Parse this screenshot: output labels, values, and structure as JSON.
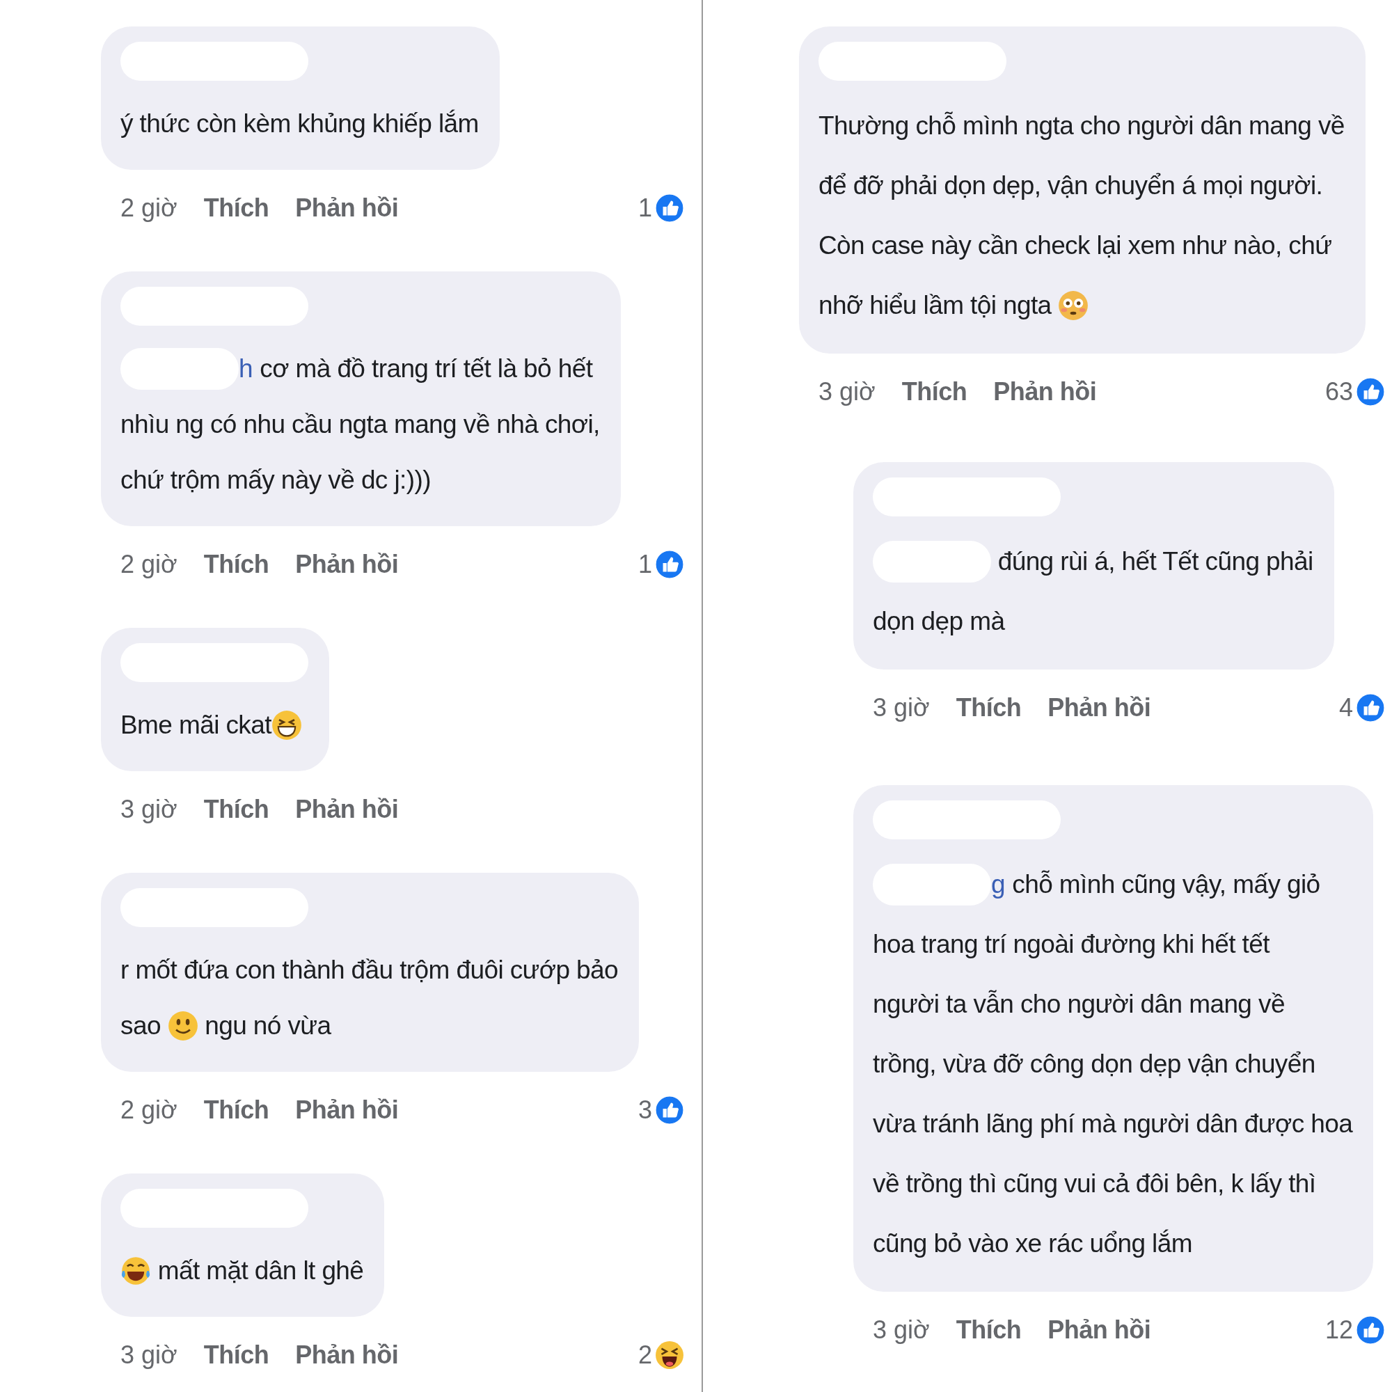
{
  "columns": [
    {
      "comments": [
        {
          "lines": [
            [
              {
                "kind": "text",
                "text": "ý thức còn kèm khủng khiếp lắm"
              }
            ]
          ],
          "time": "2 giờ",
          "like": "Thích",
          "reply": "Phản hồi",
          "reaction": {
            "kind": "like",
            "count": "1"
          }
        },
        {
          "lines": [
            [
              {
                "kind": "mention",
                "text": "h"
              },
              {
                "kind": "text",
                "text": " cơ mà đồ trang trí tết là bỏ hết"
              }
            ],
            [
              {
                "kind": "text",
                "text": "nhìu ng có nhu cầu ngta mang về nhà chơi,"
              }
            ],
            [
              {
                "kind": "text",
                "text": "chứ trộm mấy này về dc j:)))"
              }
            ]
          ],
          "time": "2 giờ",
          "like": "Thích",
          "reply": "Phản hồi",
          "reaction": {
            "kind": "like",
            "count": "1"
          }
        },
        {
          "lines": [
            [
              {
                "kind": "text",
                "text": "Bme mãi ckat"
              },
              {
                "kind": "grin"
              }
            ]
          ],
          "time": "3 giờ",
          "like": "Thích",
          "reply": "Phản hồi"
        },
        {
          "lines": [
            [
              {
                "kind": "text",
                "text": "r mốt đứa con thành đầu trộm đuôi cướp bảo"
              }
            ],
            [
              {
                "kind": "text",
                "text": "sao "
              },
              {
                "kind": "smile"
              },
              {
                "kind": "text",
                "text": " ngu nó vừa"
              }
            ]
          ],
          "time": "2 giờ",
          "like": "Thích",
          "reply": "Phản hồi",
          "reaction": {
            "kind": "like",
            "count": "3"
          }
        },
        {
          "lines": [
            [
              {
                "kind": "tears"
              },
              {
                "kind": "text",
                "text": " mất mặt dân lt ghê"
              }
            ]
          ],
          "time": "3 giờ",
          "like": "Thích",
          "reply": "Phản hồi",
          "reaction": {
            "kind": "haha",
            "count": "2"
          }
        }
      ]
    },
    {
      "comments": [
        {
          "lines": [
            [
              {
                "kind": "text",
                "text": "Thường chỗ mình ngta cho người dân mang về"
              }
            ],
            [
              {
                "kind": "text",
                "text": "để đỡ phải dọn dẹp, vận chuyển á mọi người."
              }
            ],
            [
              {
                "kind": "text",
                "text": "Còn case này cần check lại xem như nào, chứ"
              }
            ],
            [
              {
                "kind": "text",
                "text": "nhỡ hiểu lầm tội ngta "
              },
              {
                "kind": "flushed"
              }
            ]
          ],
          "time": "3 giờ",
          "like": "Thích",
          "reply": "Phản hồi",
          "reaction": {
            "kind": "like",
            "count": "63"
          },
          "children": [
            {
              "lines": [
                [
                  {
                    "kind": "mention"
                  },
                  {
                    "kind": "text",
                    "text": " đúng rùi á, hết Tết cũng phải"
                  }
                ],
                [
                  {
                    "kind": "text",
                    "text": "dọn dẹp mà"
                  }
                ]
              ],
              "time": "3 giờ",
              "like": "Thích",
              "reply": "Phản hồi",
              "reaction": {
                "kind": "like",
                "count": "4"
              }
            },
            {
              "lines": [
                [
                  {
                    "kind": "mention",
                    "text": "g"
                  },
                  {
                    "kind": "text",
                    "text": " chỗ mình cũng vậy, mấy giỏ"
                  }
                ],
                [
                  {
                    "kind": "text",
                    "text": "hoa trang trí ngoài đường khi hết tết"
                  }
                ],
                [
                  {
                    "kind": "text",
                    "text": "người ta vẫn cho người dân mang về"
                  }
                ],
                [
                  {
                    "kind": "text",
                    "text": "trồng, vừa đỡ công dọn dẹp vận chuyển"
                  }
                ],
                [
                  {
                    "kind": "text",
                    "text": "vừa tránh lãng phí mà người dân được hoa"
                  }
                ],
                [
                  {
                    "kind": "text",
                    "text": "về trồng thì cũng vui cả đôi bên, k lấy thì"
                  }
                ],
                [
                  {
                    "kind": "text",
                    "text": "cũng bỏ vào xe rác uổng lắm"
                  }
                ]
              ],
              "time": "3 giờ",
              "like": "Thích",
              "reply": "Phản hồi",
              "reaction": {
                "kind": "like",
                "count": "12"
              }
            }
          ]
        }
      ]
    }
  ]
}
